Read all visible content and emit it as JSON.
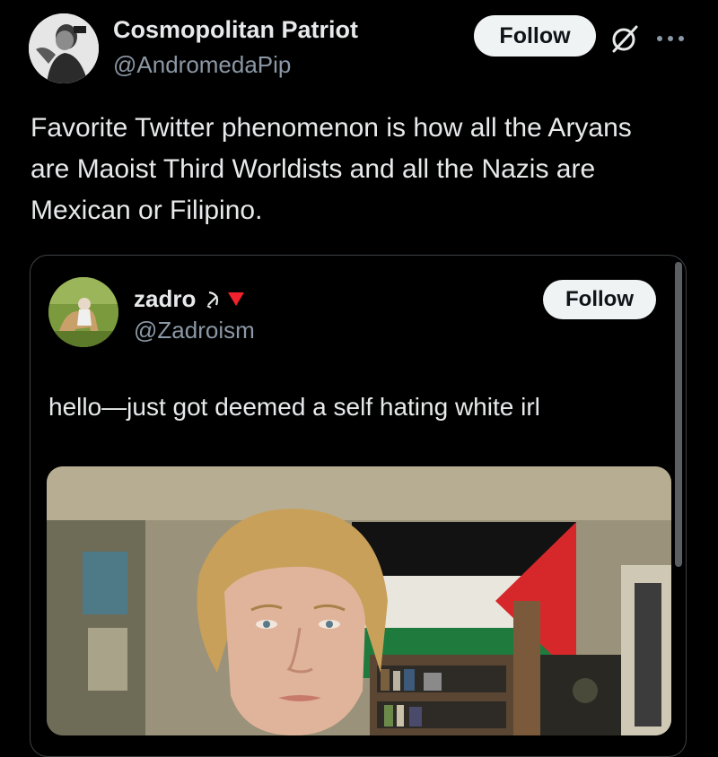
{
  "tweet": {
    "author_name": "Cosmopolitan Patriot",
    "author_handle": "@AndromedaPip",
    "follow_label": "Follow",
    "text": "Favorite Twitter phenomenon is how all the Aryans are Maoist Third Worldists and all the Nazis are Mexican or Filipino.",
    "icons": [
      "avatar",
      "grok-icon",
      "more-options-icon"
    ]
  },
  "quoted_tweet": {
    "author_name": "zadro",
    "author_handle": "@Zadroism",
    "follow_label": "Follow",
    "text": "hello—just got deemed a self hating white irl",
    "name_icons": [
      "hammer-and-sickle-icon",
      "red-triangle-icon"
    ],
    "media": "photo"
  },
  "colors": {
    "background": "#000000",
    "text_primary": "#e7e9ea",
    "text_secondary": "#8b98a5",
    "button_bg": "#eff3f4",
    "button_text": "#0f1419",
    "card_border": "#3e4144",
    "triangle": "#f4212e"
  }
}
